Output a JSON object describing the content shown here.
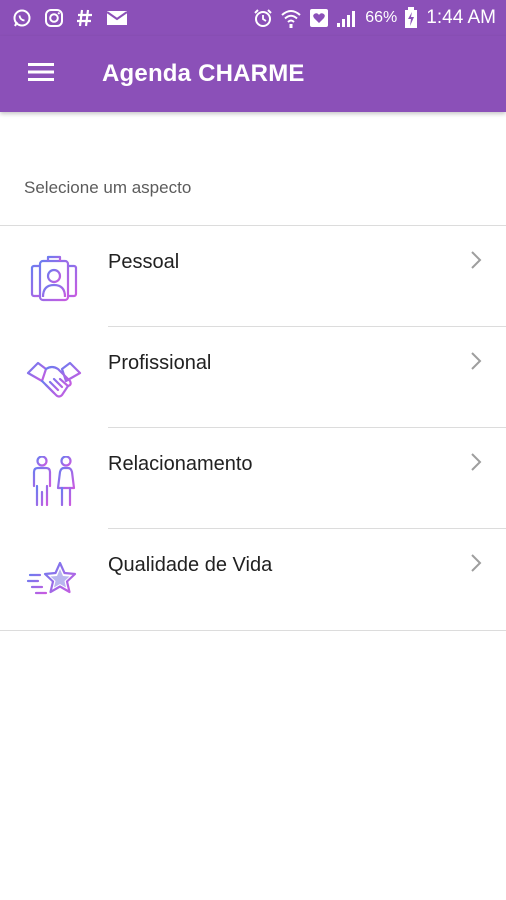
{
  "status_bar": {
    "left_icons": [
      "whatsapp-icon",
      "instagram-icon",
      "hashtag-icon",
      "mail-icon"
    ],
    "right_icons": [
      "alarm-icon",
      "wifi-icon",
      "heart-notification-icon",
      "signal-icon",
      "battery-charging-icon"
    ],
    "battery": "66%",
    "time": "1:44 AM"
  },
  "app_bar": {
    "menu_icon": "hamburger-menu-icon",
    "title": "Agenda CHARME"
  },
  "main": {
    "section_label": "Selecione um aspecto",
    "items": [
      {
        "label": "Pessoal",
        "icon": "personal-profile-icon"
      },
      {
        "label": "Profissional",
        "icon": "handshake-icon"
      },
      {
        "label": "Relacionamento",
        "icon": "couple-icon"
      },
      {
        "label": "Qualidade de Vida",
        "icon": "star-icon"
      }
    ]
  },
  "colors": {
    "primary": "#8b50b8",
    "icon_gradient_start": "#6b7cf0",
    "icon_gradient_end": "#c95be0",
    "divider": "#dcdcdc",
    "chevron": "#9e9e9e"
  }
}
